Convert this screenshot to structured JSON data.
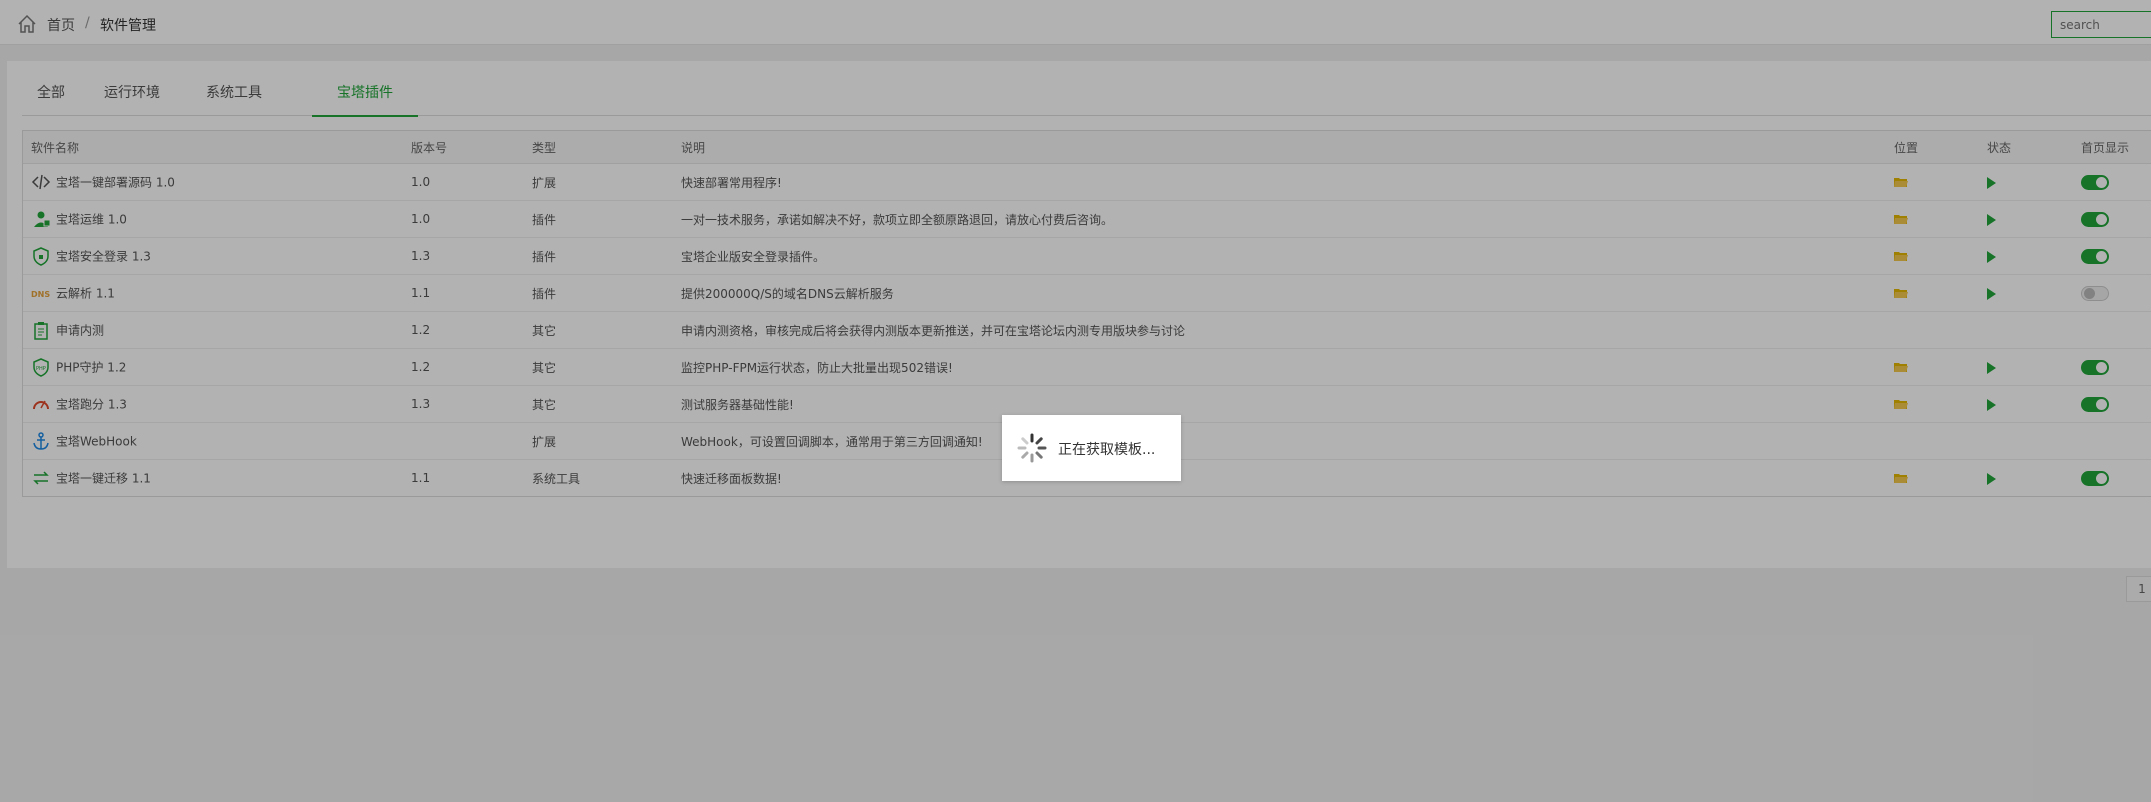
{
  "breadcrumb": {
    "home": "首页",
    "separator": "/",
    "current": "软件管理"
  },
  "search": {
    "placeholder": "search"
  },
  "tabs": [
    "全部",
    "运行环境",
    "系统工具",
    "宝塔插件"
  ],
  "active_tab": 3,
  "table": {
    "headers": [
      "软件名称",
      "版本号",
      "类型",
      "说明",
      "位置",
      "状态",
      "首页显示"
    ],
    "rows": [
      {
        "icon": "code-icon",
        "name": "宝塔一键部署源码 1.0",
        "version": "1.0",
        "type": "扩展",
        "desc": "快速部署常用程序!",
        "has_controls": true,
        "home": true
      },
      {
        "icon": "support-person-icon",
        "name": "宝塔运维 1.0",
        "version": "1.0",
        "type": "插件",
        "desc": "一对一技术服务，承诺如解决不好，款项立即全额原路退回，请放心付费后咨询。",
        "has_controls": true,
        "home": true
      },
      {
        "icon": "shield-icon",
        "name": "宝塔安全登录 1.3",
        "version": "1.3",
        "type": "插件",
        "desc": "宝塔企业版安全登录插件。",
        "has_controls": true,
        "home": true
      },
      {
        "icon": "dns-icon",
        "name": "云解析 1.1",
        "version": "1.1",
        "type": "插件",
        "desc": "提供200000Q/S的域名DNS云解析服务",
        "has_controls": true,
        "home": false
      },
      {
        "icon": "clipboard-icon",
        "name": "申请内测",
        "version": "1.2",
        "type": "其它",
        "desc": "申请内测资格，审核完成后将会获得内测版本更新推送，并可在宝塔论坛内测专用版块参与讨论",
        "has_controls": false,
        "home": null
      },
      {
        "icon": "php-shield-icon",
        "name": "PHP守护 1.2",
        "version": "1.2",
        "type": "其它",
        "desc": "监控PHP-FPM运行状态，防止大批量出现502错误!",
        "has_controls": true,
        "home": true
      },
      {
        "icon": "gauge-icon",
        "name": "宝塔跑分 1.3",
        "version": "1.3",
        "type": "其它",
        "desc": "测试服务器基础性能!",
        "has_controls": true,
        "home": true
      },
      {
        "icon": "anchor-icon",
        "name": "宝塔WebHook",
        "version": "",
        "type": "扩展",
        "desc": "WebHook，可设置回调脚本，通常用于第三方回调通知!",
        "has_controls": false,
        "home": null
      },
      {
        "icon": "transfer-arrows-icon",
        "name": "宝塔一键迁移 1.1",
        "version": "1.1",
        "type": "系统工具",
        "desc": "快速迁移面板数据!",
        "has_controls": true,
        "home": true
      }
    ]
  },
  "pagination": {
    "current_page": "1"
  },
  "loading": {
    "text": "正在获取模板..."
  },
  "colors": {
    "accent": "#20a53a",
    "folder": "#e6b800",
    "overlay": "rgba(0,0,0,0.3)"
  }
}
